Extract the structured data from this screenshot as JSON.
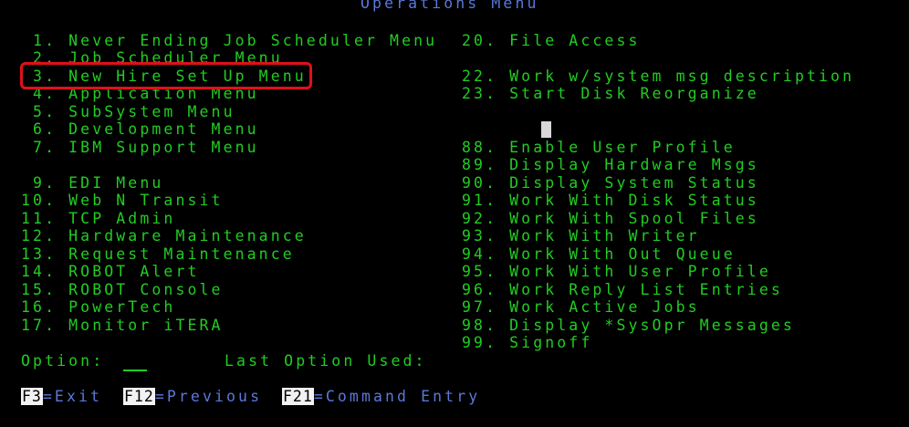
{
  "screen": {
    "title": "Operations Menu",
    "colors": {
      "background": "#000000",
      "menu_text": "#22cc22",
      "title_text": "#5a78d8",
      "fkey_text": "#5a78d8",
      "highlight_box": "#e0101a"
    }
  },
  "menu": {
    "left": [
      " 1. Never Ending Job Scheduler Menu",
      " 2. Job Scheduler Menu",
      " 3. New Hire Set Up Menu",
      " 4. Application Menu",
      " 5. SubSystem Menu",
      " 6. Development Menu",
      " 7. IBM Support Menu",
      " 9. EDI Menu",
      "10. Web N Transit",
      "11. TCP Admin",
      "12. Hardware Maintenance",
      "13. Request Maintenance",
      "14. ROBOT Alert",
      "15. ROBOT Console",
      "16. PowerTech",
      "17. Monitor iTERA"
    ],
    "right": [
      "20. File Access",
      "22. Work w/system msg description",
      "23. Start Disk Reorganize",
      "88. Enable User Profile",
      "89. Display Hardware Msgs",
      "90. Display System Status",
      "91. Work With Disk Status",
      "92. Work With Spool Files",
      "93. Work With Writer",
      "94. Work With Out Queue",
      "95. Work With User Profile",
      "96. Work Reply List Entries",
      "97. Work Active Jobs",
      "98. Display *SysOpr Messages",
      "99. Signoff"
    ]
  },
  "prompt": {
    "option_label": "Option:",
    "option_value": "",
    "last_option_label": "Last Option Used:"
  },
  "function_keys": [
    {
      "key": "F3",
      "label": "=Exit"
    },
    {
      "key": "F12",
      "label": "=Previous"
    },
    {
      "key": "F21",
      "label": "=Command Entry"
    }
  ]
}
